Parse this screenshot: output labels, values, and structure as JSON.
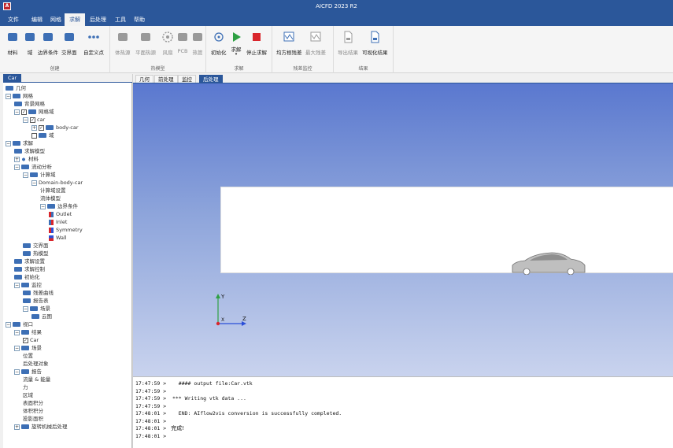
{
  "window": {
    "title": "AICFD 2023 R2",
    "app_icon_glyph": "A"
  },
  "menu": [
    {
      "label": "文件",
      "active": false
    },
    {
      "label": "编辑",
      "active": false
    },
    {
      "label": "网格",
      "active": false
    },
    {
      "label": "求解",
      "active": true
    },
    {
      "label": "后处理",
      "active": false
    },
    {
      "label": "工具",
      "active": false
    },
    {
      "label": "帮助",
      "active": false
    }
  ],
  "ribbon": {
    "groups": [
      {
        "title": "创建",
        "buttons": [
          "材料",
          "域",
          "边界条件",
          "交界面",
          "自定义点"
        ]
      },
      {
        "title": "热模型",
        "buttons": [
          "体热源",
          "平面热源",
          "风扇",
          "PCB",
          "热管"
        ]
      },
      {
        "title": "求解",
        "buttons": [
          "初始化",
          "求解",
          "停止求解"
        ]
      },
      {
        "title": "残差监控",
        "buttons": [
          "均方根残差",
          "最大残差"
        ]
      },
      {
        "title": "结果",
        "buttons": [
          "导出结果",
          "可视化结果"
        ]
      }
    ],
    "icon_names": [
      "material-icon",
      "domain-icon",
      "boundary-icon",
      "interface-icon",
      "custom-point-icon",
      "volume-heat-icon",
      "plane-heat-icon",
      "fan-icon",
      "pcb-icon",
      "heat-pipe-icon",
      "initialize-icon",
      "run-icon",
      "stop-icon",
      "rms-residual-icon",
      "max-residual-icon",
      "export-icon",
      "visualize-icon"
    ],
    "colors": {
      "accent": "#2b579a",
      "run": "#2ea043",
      "stop": "#d9262c"
    }
  },
  "left_panel": {
    "tab": "Car",
    "tree": [
      {
        "label": "几何",
        "depth": 0,
        "expander": "",
        "check": "",
        "icon": "folder"
      },
      {
        "label": "网格",
        "depth": 0,
        "expander": "-",
        "check": "",
        "icon": "folder"
      },
      {
        "label": "背景网格",
        "depth": 1,
        "expander": "",
        "check": "",
        "icon": "folder"
      },
      {
        "label": "网格域",
        "depth": 1,
        "expander": "-",
        "check": "✓",
        "icon": "folder"
      },
      {
        "label": "car",
        "depth": 2,
        "expander": "-",
        "check": "✓",
        "icon": ""
      },
      {
        "label": "body-car",
        "depth": 3,
        "expander": "+",
        "check": "✓",
        "icon": "folder"
      },
      {
        "label": "域",
        "depth": 3,
        "expander": "",
        "check": "□",
        "icon": "folder"
      },
      {
        "label": "求解",
        "depth": 0,
        "expander": "-",
        "check": "",
        "icon": "folder"
      },
      {
        "label": "求解模型",
        "depth": 1,
        "expander": "",
        "check": "",
        "icon": "folder"
      },
      {
        "label": "材料",
        "depth": 1,
        "expander": "+",
        "check": "",
        "icon": "material"
      },
      {
        "label": "流动分析",
        "depth": 1,
        "expander": "-",
        "check": "",
        "icon": "folder"
      },
      {
        "label": "计算域",
        "depth": 2,
        "expander": "-",
        "check": "",
        "icon": "folder"
      },
      {
        "label": "Domain-body-car",
        "depth": 3,
        "expander": "-",
        "check": "",
        "icon": ""
      },
      {
        "label": "计算域设置",
        "depth": 4,
        "expander": "",
        "check": "",
        "icon": ""
      },
      {
        "label": "流体模型",
        "depth": 4,
        "expander": "",
        "check": "",
        "icon": ""
      },
      {
        "label": "边界条件",
        "depth": 4,
        "expander": "-",
        "check": "",
        "icon": "folder"
      },
      {
        "label": "Outlet",
        "depth": 5,
        "expander": "",
        "check": "",
        "icon": "outlet"
      },
      {
        "label": "Inlet",
        "depth": 5,
        "expander": "",
        "check": "",
        "icon": "inlet"
      },
      {
        "label": "Symmetry",
        "depth": 5,
        "expander": "",
        "check": "",
        "icon": "symmetry"
      },
      {
        "label": "Wall",
        "depth": 5,
        "expander": "",
        "check": "",
        "icon": "wall"
      },
      {
        "label": "交界面",
        "depth": 2,
        "expander": "",
        "check": "",
        "icon": "folder"
      },
      {
        "label": "热模型",
        "depth": 2,
        "expander": "",
        "check": "",
        "icon": "folder"
      },
      {
        "label": "求解设置",
        "depth": 1,
        "expander": "",
        "check": "",
        "icon": "folder"
      },
      {
        "label": "求解控制",
        "depth": 1,
        "expander": "",
        "check": "",
        "icon": "folder"
      },
      {
        "label": "初始化",
        "depth": 1,
        "expander": "",
        "check": "",
        "icon": "folder"
      },
      {
        "label": "监控",
        "depth": 1,
        "expander": "-",
        "check": "",
        "icon": "folder"
      },
      {
        "label": "残差曲线",
        "depth": 2,
        "expander": "",
        "check": "",
        "icon": "folder"
      },
      {
        "label": "报告表",
        "depth": 2,
        "expander": "",
        "check": "",
        "icon": "folder"
      },
      {
        "label": "场景",
        "depth": 2,
        "expander": "-",
        "check": "",
        "icon": "folder"
      },
      {
        "label": "云图",
        "depth": 3,
        "expander": "",
        "check": "",
        "icon": "folder"
      },
      {
        "label": "视口",
        "depth": 0,
        "expander": "-",
        "check": "",
        "icon": "folder"
      },
      {
        "label": "结果",
        "depth": 1,
        "expander": "-",
        "check": "",
        "icon": "folder"
      },
      {
        "label": "Car",
        "depth": 2,
        "expander": "",
        "check": "✓",
        "icon": ""
      },
      {
        "label": "场景",
        "depth": 1,
        "expander": "-",
        "check": "",
        "icon": "folder"
      },
      {
        "label": "位置",
        "depth": 2,
        "expander": "",
        "check": "",
        "icon": ""
      },
      {
        "label": "后处理对象",
        "depth": 2,
        "expander": "",
        "check": "",
        "icon": ""
      },
      {
        "label": "报告",
        "depth": 1,
        "expander": "-",
        "check": "",
        "icon": "folder"
      },
      {
        "label": "流量 & 能量",
        "depth": 2,
        "expander": "",
        "check": "",
        "icon": ""
      },
      {
        "label": "力",
        "depth": 2,
        "expander": "",
        "check": "",
        "icon": ""
      },
      {
        "label": "区域",
        "depth": 2,
        "expander": "",
        "check": "",
        "icon": ""
      },
      {
        "label": "表面积分",
        "depth": 2,
        "expander": "",
        "check": "",
        "icon": ""
      },
      {
        "label": "体积积分",
        "depth": 2,
        "expander": "",
        "check": "",
        "icon": ""
      },
      {
        "label": "投影面积",
        "depth": 2,
        "expander": "",
        "check": "",
        "icon": ""
      },
      {
        "label": "旋转机械后处理",
        "depth": 1,
        "expander": "+",
        "check": "",
        "icon": "folder"
      }
    ]
  },
  "viewport_tabs": [
    {
      "label": "几何",
      "active": false
    },
    {
      "label": "前处理",
      "active": false
    },
    {
      "label": "监控",
      "active": false
    },
    {
      "label": "后处理",
      "active": true
    }
  ],
  "viewport": {
    "axes": {
      "x": "X",
      "y": "Y",
      "z": "Z"
    },
    "colors": {
      "sky_top": "#5a78cf",
      "sky_bottom": "#c9d3ee",
      "axis_x": "#d9262c",
      "axis_y": "#2ea043",
      "axis_z": "#2b4fd8"
    }
  },
  "console": [
    {
      "time": "17:47:59",
      "text": "   #### output file:Car.vtk"
    },
    {
      "time": "17:47:59",
      "text": ""
    },
    {
      "time": "17:47:59",
      "text": " *** Writing vtk data ..."
    },
    {
      "time": "17:47:59",
      "text": ""
    },
    {
      "time": "17:48:01",
      "text": "   END: AIflow2vis conversion is successfully completed."
    },
    {
      "time": "17:48:01",
      "text": ""
    },
    {
      "time": "17:48:01",
      "text": " 完成!"
    },
    {
      "time": "17:48:01",
      "text": ""
    }
  ]
}
